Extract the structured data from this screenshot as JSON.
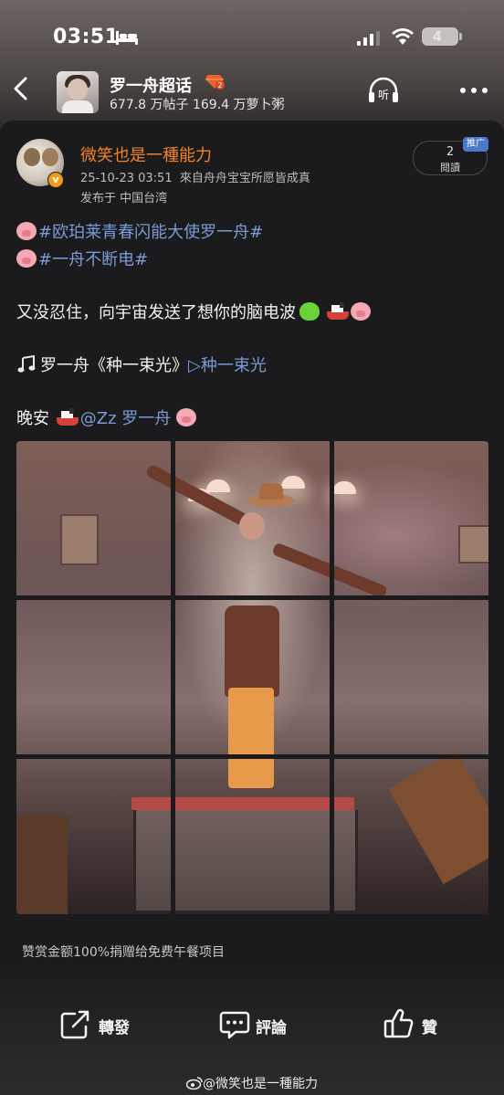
{
  "status_bar": {
    "time": "03:51",
    "battery": "4"
  },
  "header": {
    "title": "罗一舟超话",
    "badge_level": "2",
    "stats": "677.8 万帖子 169.4 万萝卜粥",
    "listen_label": "听"
  },
  "post": {
    "author": "微笑也是一種能力",
    "verified_mark": "v",
    "datetime": "25-10-23 03:51",
    "source": "來自舟舟宝宝所愿皆成真",
    "location": "发布于 中国台湾",
    "reads_count": "2",
    "reads_label": "閱讀",
    "promo_label": "推广",
    "hashtag1": "#欧珀莱青春闪能大使罗一舟#",
    "hashtag2": "#一舟不断电#",
    "text1": "又没忍住，向宇宙发送了想你的脑电波",
    "song_text": "罗一舟《种一束光》",
    "song_link": "▷种一束光",
    "goodnight": "晚安",
    "mention": "@Zz 罗一舟"
  },
  "reward_text": "赞赏金额100%捐赠给免费午餐项目",
  "actions": {
    "repost": "轉發",
    "comment": "評論",
    "like": "贊"
  },
  "watermark": "@微笑也是一種能力",
  "colors": {
    "author": "#f3832b",
    "hashtag": "#7a9bd6",
    "promo": "#4b78c8"
  }
}
